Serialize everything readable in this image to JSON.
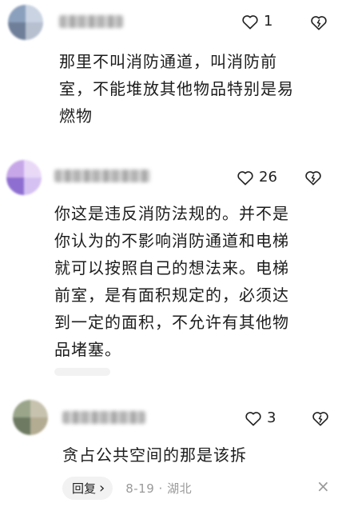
{
  "comments": [
    {
      "likes": "1",
      "lines": [
        "那里不叫消防通道，叫消防前",
        "室，不能堆放其他物品特别是易",
        "燃物"
      ]
    },
    {
      "likes": "26",
      "lines": [
        "你这是违反消防法规的。并不是",
        "你认为的不影响消防通道和电梯",
        "就可以按照自己的想法来。电梯",
        "前室，是有面积规定的，必须达",
        "到一定的面积，不允许有其他物",
        "品堵塞。"
      ]
    },
    {
      "likes": "3",
      "lines": [
        "贪占公共空间的那是该拆"
      ],
      "reply_label": "回复",
      "reply_arrow": "›",
      "meta": "8-19 · 湖北",
      "close_glyph": "×"
    }
  ],
  "icons": [
    "heart-icon",
    "dislike-heart-icon",
    "close-icon"
  ],
  "colors": {
    "text": "#1c1c1c",
    "meta": "#9a9a9a",
    "reply_bg": "#f2f2f2"
  }
}
